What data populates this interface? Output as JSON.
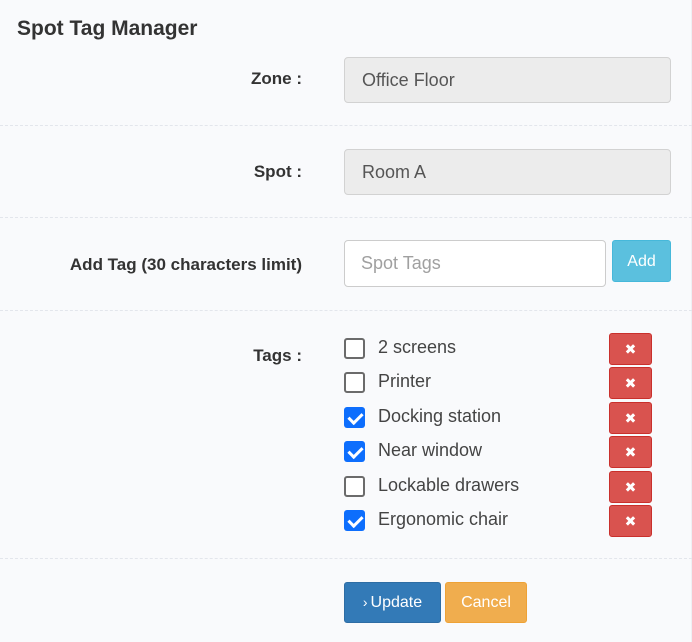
{
  "title": "Spot Tag Manager",
  "zone": {
    "label": "Zone :",
    "value": "Office Floor"
  },
  "spot": {
    "label": "Spot :",
    "value": "Room A"
  },
  "add_tag": {
    "label": "Add Tag (30 characters limit)",
    "placeholder": "Spot Tags",
    "value": "",
    "button": "Add"
  },
  "tags": {
    "label": "Tags :",
    "items": [
      {
        "name": "2 screens",
        "checked": false
      },
      {
        "name": "Printer",
        "checked": false
      },
      {
        "name": "Docking station",
        "checked": true
      },
      {
        "name": "Near window",
        "checked": true
      },
      {
        "name": "Lockable drawers",
        "checked": false
      },
      {
        "name": "Ergonomic chair",
        "checked": true
      }
    ],
    "delete_icon": "times-icon"
  },
  "actions": {
    "update_icon": "chevron-right-icon",
    "update": "Update",
    "cancel": "Cancel"
  },
  "colors": {
    "primary": "#337ab7",
    "info": "#5bc0de",
    "warning": "#f0ad4e",
    "danger": "#d9534f",
    "checkbox": "#0d6efd"
  }
}
